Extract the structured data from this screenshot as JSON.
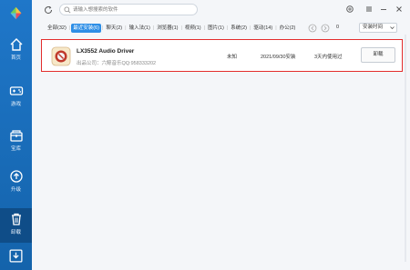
{
  "sidebar": {
    "items": [
      {
        "label": "首页",
        "icon": "home-icon"
      },
      {
        "label": "游戏",
        "icon": "gamepad-icon"
      },
      {
        "label": "宝库",
        "icon": "chest-icon"
      },
      {
        "label": "升级",
        "icon": "upgrade-icon"
      },
      {
        "label": "卸载",
        "icon": "trash-icon",
        "active": true
      }
    ],
    "bottom_icon": "download-icon"
  },
  "search": {
    "placeholder": "请输入想搜索的软件"
  },
  "tabs": [
    {
      "label": "全部(32)"
    },
    {
      "label": "最近安装(6)",
      "active": true
    },
    {
      "label": "聊天(2)"
    },
    {
      "label": "输入法(1)"
    },
    {
      "label": "浏览器(1)"
    },
    {
      "label": "视频(1)"
    },
    {
      "label": "图片(1)"
    },
    {
      "label": "系统(2)"
    },
    {
      "label": "驱动(14)"
    },
    {
      "label": "办公(2)"
    }
  ],
  "tabs_extra_value": "0",
  "sort": {
    "label": "安装时间"
  },
  "apps": [
    {
      "name": "LX3552 Audio Driver",
      "publisher": "出品公司：六鲸音乐QQ:958333202",
      "size": "未知",
      "install_date": "2021/09/30安装",
      "last_used": "3天内使用过",
      "action": "卸载"
    }
  ],
  "colors": {
    "sidebar": "#1f77c9",
    "active_tab": "#2d8ee6",
    "highlight_border": "#e32d2d"
  }
}
